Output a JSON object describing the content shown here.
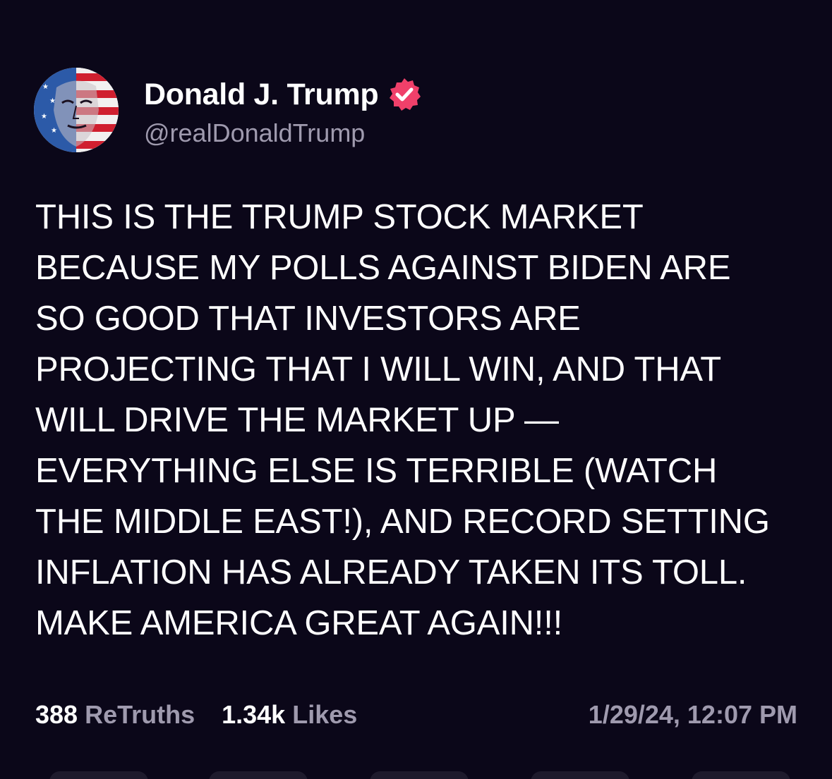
{
  "post": {
    "author": {
      "display_name": "Donald J. Trump",
      "handle": "@realDonaldTrump",
      "verified": true,
      "verified_icon": "verified-badge-icon"
    },
    "text": "THIS IS THE TRUMP STOCK MARKET\nBECAUSE MY POLLS AGAINST BIDEN ARE\nSO GOOD THAT INVESTORS ARE\nPROJECTING THAT I WILL WIN, AND THAT\nWILL DRIVE THE MARKET UP —\nEVERYTHING ELSE IS TERRIBLE (WATCH\nTHE MIDDLE EAST!), AND RECORD SETTING\nINFLATION HAS ALREADY TAKEN ITS TOLL.\nMAKE AMERICA GREAT AGAIN!!!",
    "stats": {
      "retruths_count": "388",
      "retruths_label": "ReTruths",
      "likes_count": "1.34k",
      "likes_label": "Likes"
    },
    "timestamp": "1/29/24, 12:07 PM"
  },
  "colors": {
    "background": "#0b0719",
    "primary_text": "#ffffff",
    "secondary_text": "#9f9aae",
    "verified_badge": "#f0406a"
  }
}
